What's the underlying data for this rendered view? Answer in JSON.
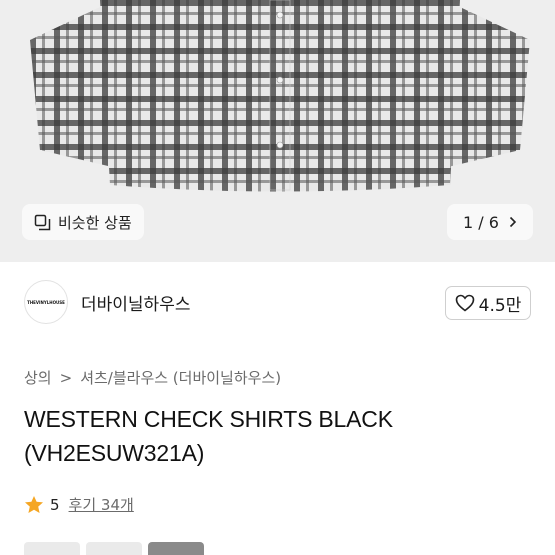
{
  "product_image": {
    "similar_button_label": "비슷한 상품",
    "pager": {
      "current": "1",
      "separator": "/",
      "total": "6"
    }
  },
  "seller": {
    "name": "더바이닐하우스",
    "avatar_text": "THEVINYLHOUSE",
    "likes": "4.5만"
  },
  "breadcrumb": {
    "items": [
      "상의",
      "셔츠/블라우스 (더바이닐하우스)"
    ],
    "separator": ">"
  },
  "product": {
    "title": "WESTERN CHECK SHIRTS BLACK (VH2ESUW321A)"
  },
  "rating": {
    "score": "5",
    "reviews": "후기 34개"
  },
  "colors": {
    "accent_star": "#f5a623",
    "image_bg": "#eeeeee"
  }
}
